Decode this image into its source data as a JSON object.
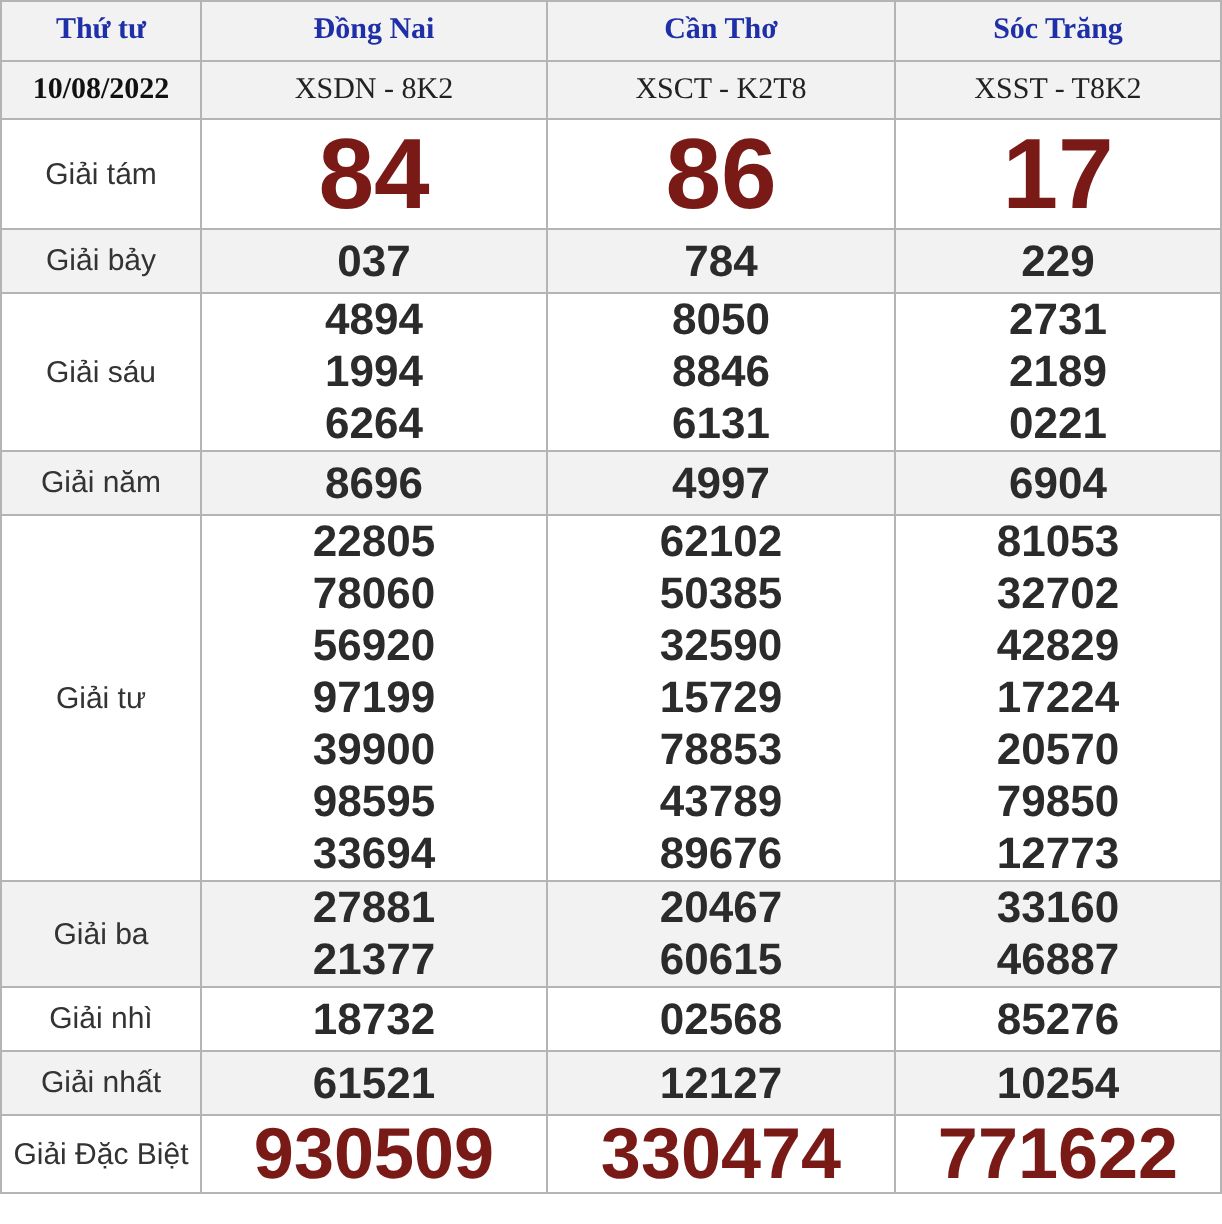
{
  "header": {
    "day": "Thứ tư",
    "provinces": [
      "Đồng Nai",
      "Cần Thơ",
      "Sóc Trăng"
    ]
  },
  "date": "10/08/2022",
  "codes": [
    "XSDN - 8K2",
    "XSCT - K2T8",
    "XSST - T8K2"
  ],
  "prizes": [
    {
      "label": "Giải tám",
      "kind": "eighth",
      "results": [
        [
          "84"
        ],
        [
          "86"
        ],
        [
          "17"
        ]
      ]
    },
    {
      "label": "Giải bảy",
      "kind": "normal",
      "results": [
        [
          "037"
        ],
        [
          "784"
        ],
        [
          "229"
        ]
      ]
    },
    {
      "label": "Giải sáu",
      "kind": "normal",
      "results": [
        [
          "4894",
          "1994",
          "6264"
        ],
        [
          "8050",
          "8846",
          "6131"
        ],
        [
          "2731",
          "2189",
          "0221"
        ]
      ]
    },
    {
      "label": "Giải năm",
      "kind": "normal",
      "results": [
        [
          "8696"
        ],
        [
          "4997"
        ],
        [
          "6904"
        ]
      ]
    },
    {
      "label": "Giải tư",
      "kind": "normal",
      "results": [
        [
          "22805",
          "78060",
          "56920",
          "97199",
          "39900",
          "98595",
          "33694"
        ],
        [
          "62102",
          "50385",
          "32590",
          "15729",
          "78853",
          "43789",
          "89676"
        ],
        [
          "81053",
          "32702",
          "42829",
          "17224",
          "20570",
          "79850",
          "12773"
        ]
      ]
    },
    {
      "label": "Giải ba",
      "kind": "normal",
      "results": [
        [
          "27881",
          "21377"
        ],
        [
          "20467",
          "60615"
        ],
        [
          "33160",
          "46887"
        ]
      ]
    },
    {
      "label": "Giải nhì",
      "kind": "normal",
      "results": [
        [
          "18732"
        ],
        [
          "02568"
        ],
        [
          "85276"
        ]
      ]
    },
    {
      "label": "Giải nhất",
      "kind": "normal",
      "results": [
        [
          "61521"
        ],
        [
          "12127"
        ],
        [
          "10254"
        ]
      ]
    },
    {
      "label": "Giải Đặc Biệt",
      "kind": "special",
      "results": [
        [
          "930509"
        ],
        [
          "330474"
        ],
        [
          "771622"
        ]
      ]
    }
  ]
}
